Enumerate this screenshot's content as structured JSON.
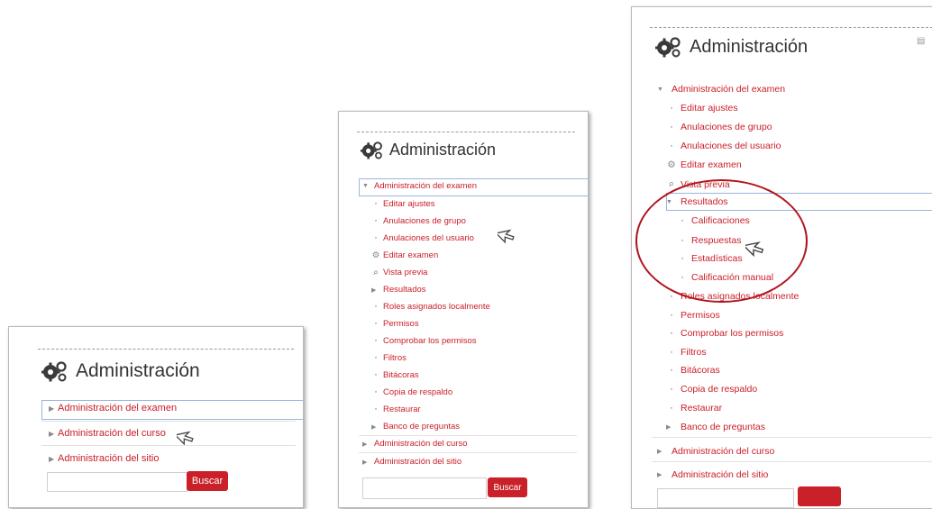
{
  "panel1": {
    "title": "Administración",
    "items": [
      {
        "label": "Administración del examen",
        "kind": "collapsed"
      },
      {
        "label": "Administración del curso",
        "kind": "collapsed"
      },
      {
        "label": "Administración del sitio",
        "kind": "collapsed"
      }
    ],
    "search": {
      "placeholder": "",
      "button": "Buscar"
    }
  },
  "panel2": {
    "title": "Administración",
    "items": [
      {
        "label": "Administración del examen",
        "kind": "expanded"
      },
      {
        "label": "Editar ajustes",
        "kind": "bullet"
      },
      {
        "label": "Anulaciones de grupo",
        "kind": "bullet"
      },
      {
        "label": "Anulaciones del usuario",
        "kind": "bullet"
      },
      {
        "label": "Editar examen",
        "kind": "gear"
      },
      {
        "label": "Vista previa",
        "kind": "search"
      },
      {
        "label": "Resultados",
        "kind": "collapsed"
      },
      {
        "label": "Roles asignados localmente",
        "kind": "bullet"
      },
      {
        "label": "Permisos",
        "kind": "bullet"
      },
      {
        "label": "Comprobar los permisos",
        "kind": "bullet"
      },
      {
        "label": "Filtros",
        "kind": "bullet"
      },
      {
        "label": "Bitácoras",
        "kind": "bullet"
      },
      {
        "label": "Copia de respaldo",
        "kind": "bullet"
      },
      {
        "label": "Restaurar",
        "kind": "bullet"
      },
      {
        "label": "Banco de preguntas",
        "kind": "collapsed"
      },
      {
        "label": "Administración del curso",
        "kind": "collapsed"
      },
      {
        "label": "Administración del sitio",
        "kind": "collapsed"
      }
    ],
    "search": {
      "placeholder": "",
      "button": "Buscar"
    }
  },
  "panel3": {
    "title": "Administración",
    "items": [
      {
        "label": "Administración del examen",
        "kind": "expanded"
      },
      {
        "label": "Editar ajustes",
        "kind": "bullet"
      },
      {
        "label": "Anulaciones de grupo",
        "kind": "bullet"
      },
      {
        "label": "Anulaciones del usuario",
        "kind": "bullet"
      },
      {
        "label": "Editar examen",
        "kind": "gear"
      },
      {
        "label": "Vista previa",
        "kind": "search"
      },
      {
        "label": "Resultados",
        "kind": "expanded"
      },
      {
        "label": "Calificaciones",
        "kind": "bullet"
      },
      {
        "label": "Respuestas",
        "kind": "bullet"
      },
      {
        "label": "Estadísticas",
        "kind": "bullet"
      },
      {
        "label": "Calificación manual",
        "kind": "bullet"
      },
      {
        "label": "Roles asignados localmente",
        "kind": "bullet"
      },
      {
        "label": "Permisos",
        "kind": "bullet"
      },
      {
        "label": "Comprobar los permisos",
        "kind": "bullet"
      },
      {
        "label": "Filtros",
        "kind": "bullet"
      },
      {
        "label": "Bitácoras",
        "kind": "bullet"
      },
      {
        "label": "Copia de respaldo",
        "kind": "bullet"
      },
      {
        "label": "Restaurar",
        "kind": "bullet"
      },
      {
        "label": "Banco de preguntas",
        "kind": "collapsed"
      },
      {
        "label": "Administración del curso",
        "kind": "collapsed"
      },
      {
        "label": "Administración del sitio",
        "kind": "collapsed"
      }
    ]
  }
}
